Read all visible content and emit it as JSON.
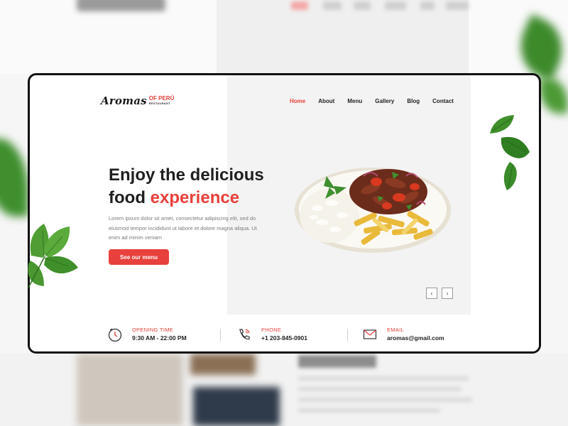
{
  "brand": {
    "name": "Aromas",
    "suffix": "OF PERÚ",
    "tagline": "RESTAURANT",
    "accent_color": "#e8403c"
  },
  "nav": {
    "items": [
      {
        "label": "Home",
        "active": true
      },
      {
        "label": "About",
        "active": false
      },
      {
        "label": "Menu",
        "active": false
      },
      {
        "label": "Gallery",
        "active": false
      },
      {
        "label": "Blog",
        "active": false
      },
      {
        "label": "Contact",
        "active": false
      }
    ]
  },
  "hero": {
    "title_line1": "Enjoy the delicious",
    "title_line2_prefix": "food ",
    "title_line2_accent": "experience",
    "description": "Lorem ipsum dolor sit amet, consectetur adipiscing elit, sed do eiusmod tempor incididunt ut labore et dolore magna aliqua. Ut enim ad minim veniam",
    "cta_label": "See our menu"
  },
  "slider": {
    "prev_icon": "chevron-left-icon",
    "next_icon": "chevron-right-icon"
  },
  "info": {
    "opening": {
      "label": "OPENING TIME",
      "value": "9:30 AM - 22:00 PM",
      "icon": "clock-icon"
    },
    "phone": {
      "label": "PHONE",
      "value": "+1 203-845-0901",
      "icon": "phone-icon"
    },
    "email": {
      "label": "EMAIL",
      "value": "aromas@gmail.com",
      "icon": "mail-icon"
    }
  }
}
